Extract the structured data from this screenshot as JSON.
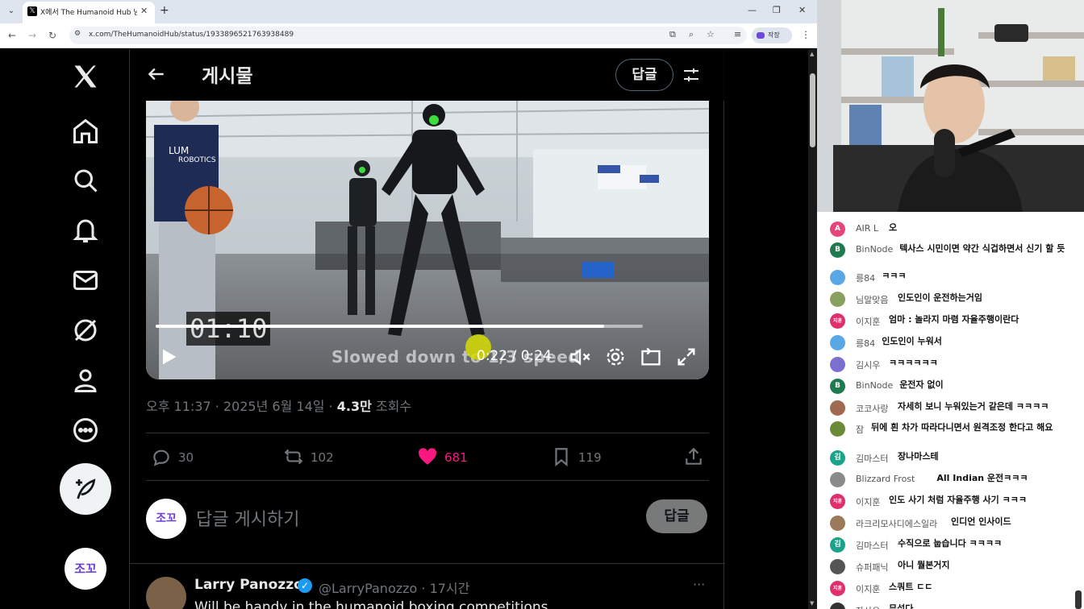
{
  "browser": {
    "tab_title": "X에서 The Humanoid Hub 님",
    "url": "x.com/TheHumanoidHub/status/1933896521763938489",
    "profile_label": "작장"
  },
  "header": {
    "title": "게시물",
    "reply_label": "답글"
  },
  "video": {
    "overlay_time": "01:10",
    "caption": "Slowed down to 1/3 speed",
    "time_readout": "0:22 / 0:24",
    "progress": 0.92,
    "shirt_text_1": "LUM",
    "shirt_text_2": "ROBOTICS"
  },
  "post": {
    "timestamp": "오후 11:37 · 2025년 6월 14일 · ",
    "views_count": "4.3만",
    "views_label": " 조회수"
  },
  "actions": {
    "replies": "30",
    "reposts": "102",
    "likes": "681",
    "bookmarks": "119"
  },
  "reply_box": {
    "avatar_text": "조꼬",
    "placeholder": "답글 게시하기",
    "submit_label": "답글"
  },
  "nav": {
    "avatar_text": "조꼬"
  },
  "reply_tweet": {
    "name": "Larry Panozzo",
    "handle": "@LarryPanozzo · 17시간",
    "more": "···",
    "text": "Will be handy in the humanoid boxing competitions"
  },
  "chat": [
    {
      "nick": "AIR L",
      "text": "오",
      "avatar": "A",
      "color": "#e6457a"
    },
    {
      "nick": "BinNode",
      "text": "텍사스 시민이면 약간 식겁하면서 신기 할 듯",
      "avatar": "B",
      "color": "#1f7a4d"
    },
    {
      "nick": "릉84",
      "text": "ㅋㅋㅋ",
      "avatar": "",
      "color": "#5aa7e6"
    },
    {
      "nick": "님말맞음",
      "text": "인도인이 운전하는거임",
      "avatar": "",
      "color": "#8aa060"
    },
    {
      "nick": "이지훈",
      "text": "엄마 : 놀라지 마렴 자율주행이란다",
      "avatar": "지훈",
      "color": "#e0306a"
    },
    {
      "nick": "릉84",
      "text": "인도인이 누워서",
      "avatar": "",
      "color": "#5aa7e6"
    },
    {
      "nick": "김시우",
      "text": "ㅋㅋㅋㅋㅋㅋ",
      "avatar": "",
      "color": "#7b6fd0"
    },
    {
      "nick": "BinNode",
      "text": "운전자 없이",
      "avatar": "B",
      "color": "#1f7a4d"
    },
    {
      "nick": "코코사랑",
      "text": "자세히 보니 누워있는거 같은데 ㅋㅋㅋㅋ",
      "avatar": "",
      "color": "#a06a50"
    },
    {
      "nick": "잠",
      "text": "뒤에 흰 차가 따라다니면서 원격조정 한다고 해요",
      "avatar": "",
      "color": "#6a8a3a"
    },
    {
      "nick": "김마스터",
      "text": "장나마스테",
      "avatar": "김",
      "color": "#1aa38a"
    },
    {
      "nick": "Blizzard Frost",
      "text": "All Indian 운전ㅋㅋㅋ",
      "avatar": "",
      "color": "#8a8a8a"
    },
    {
      "nick": "이지훈",
      "text": "인도 사기 처럼 자율주행 사기 ㅋㅋㅋ",
      "avatar": "지훈",
      "color": "#e0306a"
    },
    {
      "nick": "라크리모사디에스일라",
      "text": "인디언 인사이드",
      "avatar": "",
      "color": "#9a7a5a"
    },
    {
      "nick": "김마스터",
      "text": "수직으로 눕습니다 ㅋㅋㅋㅋ",
      "avatar": "김",
      "color": "#1aa38a"
    },
    {
      "nick": "슈퍼패닉",
      "text": "아니 뭘본거지",
      "avatar": "",
      "color": "#555555"
    },
    {
      "nick": "이지훈",
      "text": "스쿼트 ㄷㄷ",
      "avatar": "지훈",
      "color": "#e0306a"
    },
    {
      "nick": "자사오",
      "text": "무섭다",
      "avatar": "",
      "color": "#333333"
    }
  ],
  "colors": {
    "like": "#f91880",
    "verified": "#1d9bf0",
    "x_text": "#e7e9ea",
    "x_muted": "#71767b"
  }
}
